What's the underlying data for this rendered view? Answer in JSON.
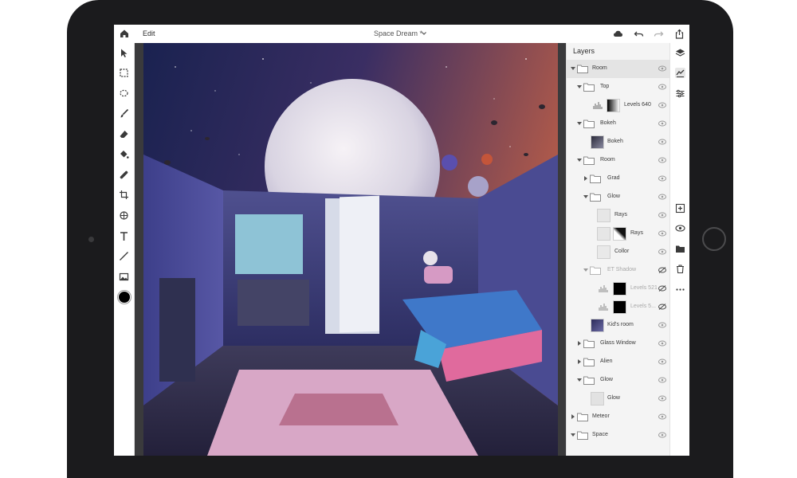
{
  "topbar": {
    "tab_label": "Edit",
    "doc_title": "Space Dream *"
  },
  "layers_panel": {
    "title": "Layers",
    "items": [
      {
        "label": "Room",
        "kind": "group",
        "depth": 0,
        "expanded": true,
        "selected": true,
        "visible": true
      },
      {
        "label": "Top",
        "kind": "group",
        "depth": 1,
        "expanded": true,
        "visible": true
      },
      {
        "label": "Levels 640",
        "kind": "adjustment",
        "depth": 2,
        "visible": true
      },
      {
        "label": "Bokeh",
        "kind": "group",
        "depth": 1,
        "expanded": true,
        "visible": true
      },
      {
        "label": "Bokeh",
        "kind": "image",
        "depth": 2,
        "visible": true
      },
      {
        "label": "Room",
        "kind": "group",
        "depth": 1,
        "expanded": true,
        "visible": true
      },
      {
        "label": "Grad",
        "kind": "group",
        "depth": 2,
        "expanded": false,
        "visible": true
      },
      {
        "label": "Glow",
        "kind": "group",
        "depth": 2,
        "expanded": true,
        "visible": true
      },
      {
        "label": "Rays",
        "kind": "image",
        "depth": 3,
        "visible": true
      },
      {
        "label": "Rays",
        "kind": "masked",
        "depth": 3,
        "visible": true
      },
      {
        "label": "Collor",
        "kind": "image",
        "depth": 3,
        "visible": true
      },
      {
        "label": "ET Shadow",
        "kind": "group",
        "depth": 2,
        "expanded": true,
        "visible": false
      },
      {
        "label": "Levels 521",
        "kind": "adjustment-masked",
        "depth": 3,
        "visible": false
      },
      {
        "label": "Levels 5...",
        "kind": "adjustment-masked",
        "depth": 3,
        "visible": false
      },
      {
        "label": "Kid's room",
        "kind": "image",
        "depth": 2,
        "visible": true
      },
      {
        "label": "Glass Window",
        "kind": "group",
        "depth": 1,
        "expanded": false,
        "visible": true
      },
      {
        "label": "Alien",
        "kind": "group",
        "depth": 1,
        "expanded": false,
        "visible": true
      },
      {
        "label": "Glow",
        "kind": "group",
        "depth": 1,
        "expanded": true,
        "visible": true
      },
      {
        "label": "Glow",
        "kind": "image",
        "depth": 2,
        "visible": true
      },
      {
        "label": "Meteor",
        "kind": "group",
        "depth": 0,
        "expanded": false,
        "visible": true
      },
      {
        "label": "Space",
        "kind": "group",
        "depth": 0,
        "expanded": true,
        "visible": true
      }
    ]
  },
  "toolbar": {
    "tools": [
      "select-arrow-icon",
      "marquee-icon",
      "lasso-icon",
      "brush-icon",
      "eraser-icon",
      "fill-bucket-icon",
      "healing-icon",
      "crop-icon",
      "clone-icon",
      "type-icon",
      "line-icon",
      "place-image-icon"
    ],
    "foreground_color": "#000000"
  },
  "colors": {
    "panel_bg": "#f4f4f4",
    "toolbar_bg": "#ffffff",
    "device": "#1b1b1d",
    "selected_row": "#e4e4e4"
  }
}
